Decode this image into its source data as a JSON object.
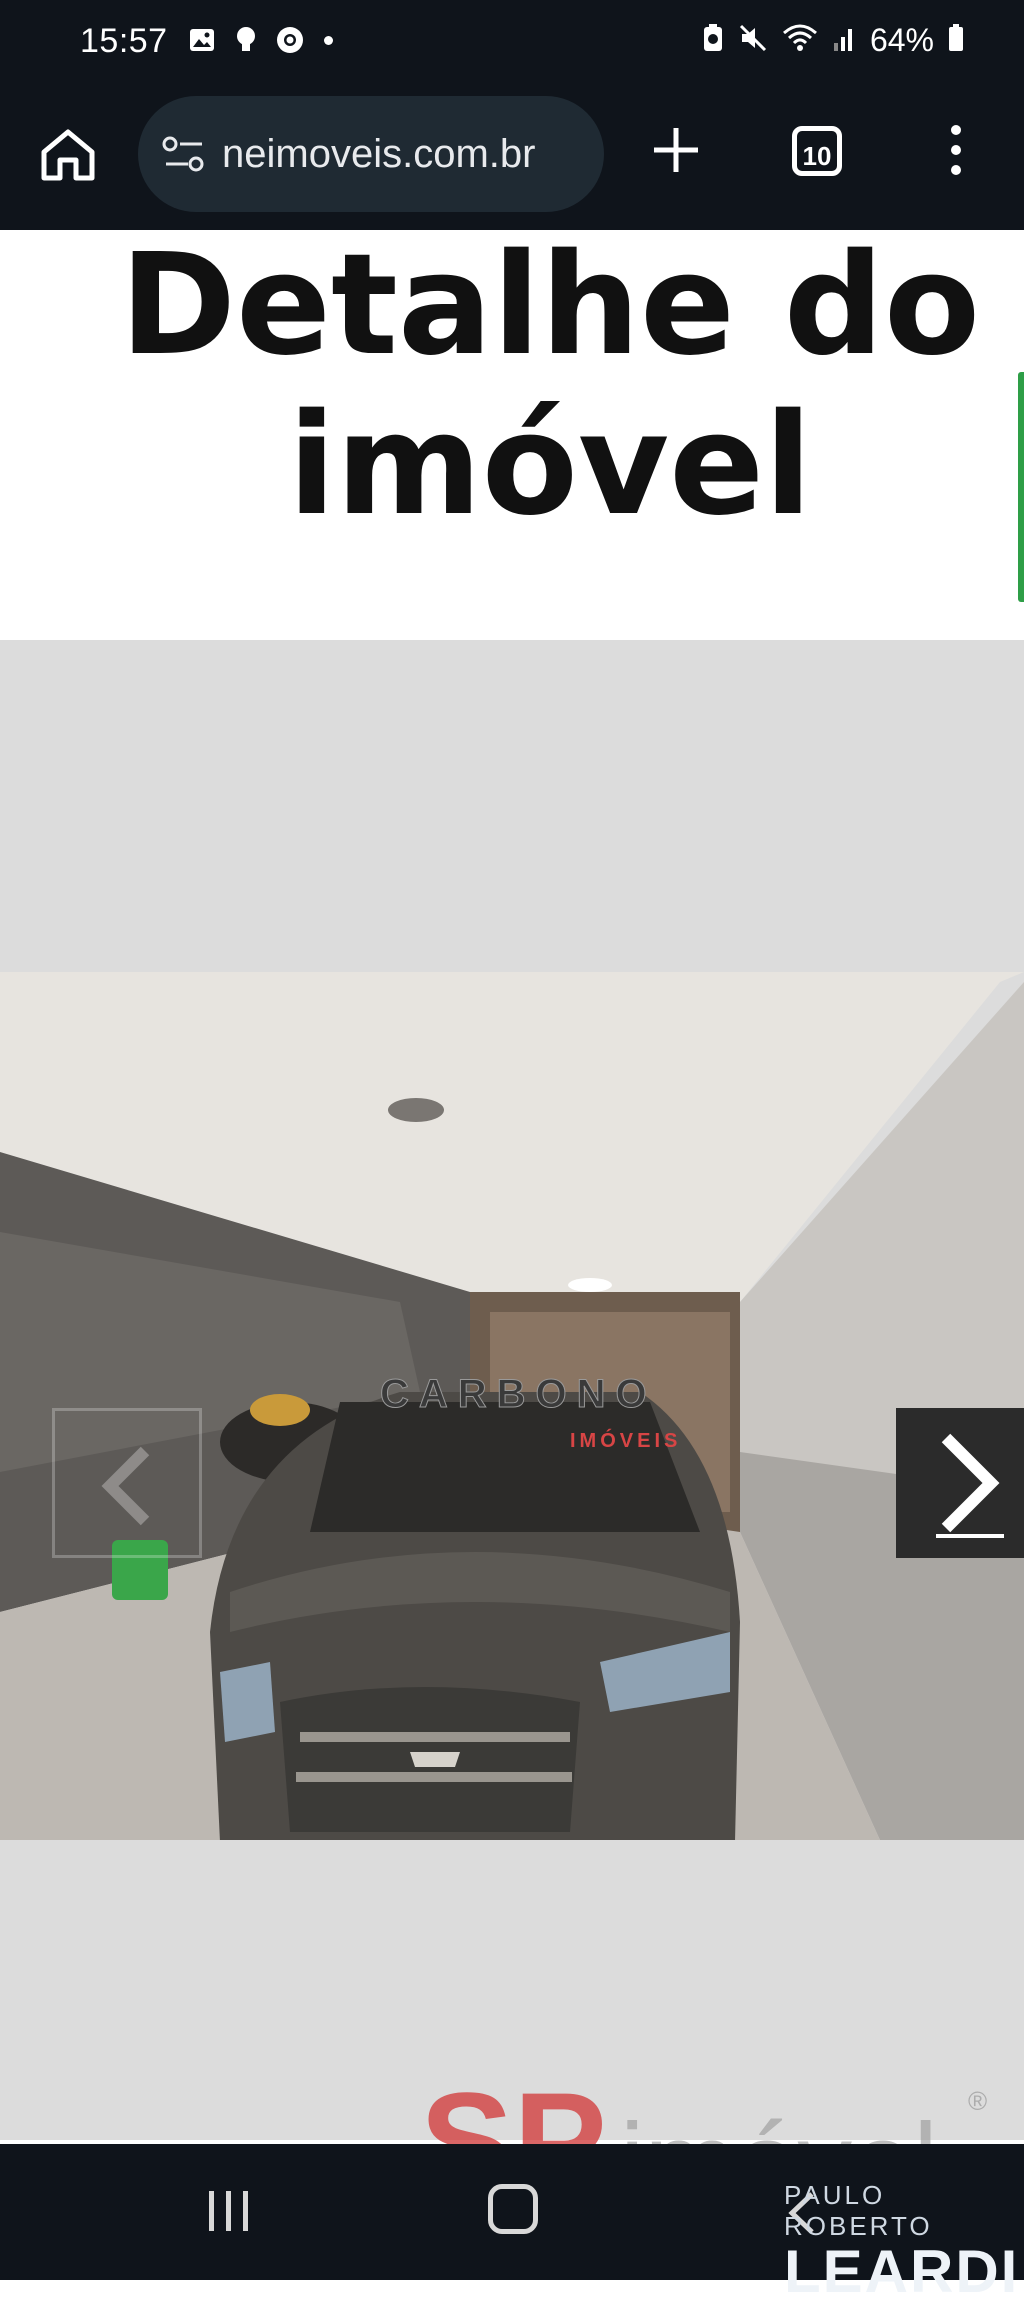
{
  "status_bar": {
    "time": "15:57",
    "battery_text": "64%",
    "icons": [
      "gallery-icon",
      "bulb-icon",
      "chrome-icon",
      "dot-icon",
      "battery-saver-icon",
      "mute-icon",
      "wifi-icon",
      "signal-icon",
      "battery-icon"
    ]
  },
  "browser": {
    "url": "neimoveis.com.br",
    "tab_count": "10",
    "icons": [
      "home-icon",
      "site-settings-icon",
      "new-tab-icon",
      "tabs-icon",
      "more-menu-icon"
    ]
  },
  "page": {
    "title": "Detalhe do imóvel",
    "photo_watermark_line1": "CARBONO",
    "photo_watermark_line2": "IMÓVEIS",
    "accent_color": "#2e9e47"
  },
  "logos": {
    "sp": "SP imóvel",
    "leardi_line1": "PAULO ROBERTO",
    "leardi_line2": "LEARDI"
  },
  "nav_bar": {
    "icons": [
      "recent-apps-icon",
      "home-nav-icon",
      "back-icon"
    ]
  }
}
